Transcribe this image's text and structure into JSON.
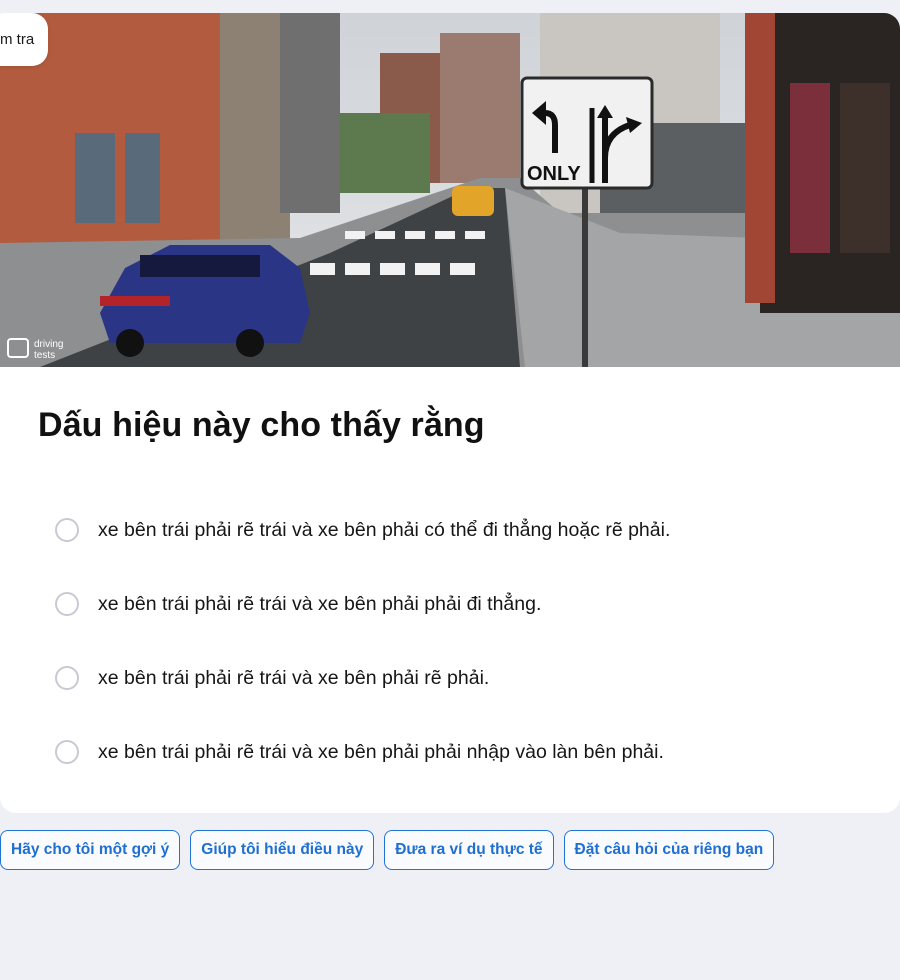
{
  "header": {
    "badge_text": "m tra"
  },
  "image": {
    "sign_label": "ONLY",
    "watermark_line1": "driving",
    "watermark_line2": "tests"
  },
  "question": {
    "title": "Dấu hiệu này cho thấy rằng"
  },
  "options": [
    {
      "label": "xe bên trái phải rẽ trái và xe bên phải có thể đi thẳng hoặc rẽ phải."
    },
    {
      "label": "xe bên trái phải rẽ trái và xe bên phải phải đi thẳng."
    },
    {
      "label": "xe bên trái phải rẽ trái và xe bên phải rẽ phải."
    },
    {
      "label": "xe bên trái phải rẽ trái và xe bên phải phải nhập vào làn bên phải."
    }
  ],
  "help": [
    {
      "label": "Hãy cho tôi một gợi ý"
    },
    {
      "label": "Giúp tôi hiểu điều này"
    },
    {
      "label": "Đưa ra ví dụ thực tế"
    },
    {
      "label": "Đặt câu hỏi của riêng bạn"
    }
  ],
  "colors": {
    "accent": "#1f74d6",
    "background": "#eff0f6",
    "card": "#ffffff"
  }
}
